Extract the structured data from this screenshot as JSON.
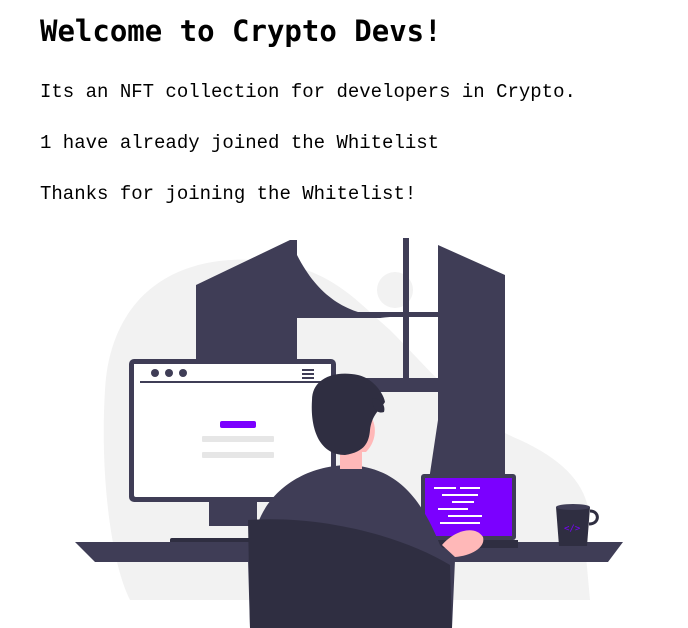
{
  "header": {
    "title": "Welcome to Crypto Devs!"
  },
  "main": {
    "description": "Its an NFT collection for developers in Crypto.",
    "whitelist_count_text": "1 have already joined the Whitelist",
    "status_message": "Thanks for joining the Whitelist!"
  },
  "illustration": {
    "alt_meaning": "developer working at desk",
    "colors": {
      "dark": "#3f3d56",
      "darker": "#2f2e41",
      "accent": "#7b00ff",
      "skin": "#ffb8b8",
      "background_blob": "#f2f2f2"
    }
  }
}
